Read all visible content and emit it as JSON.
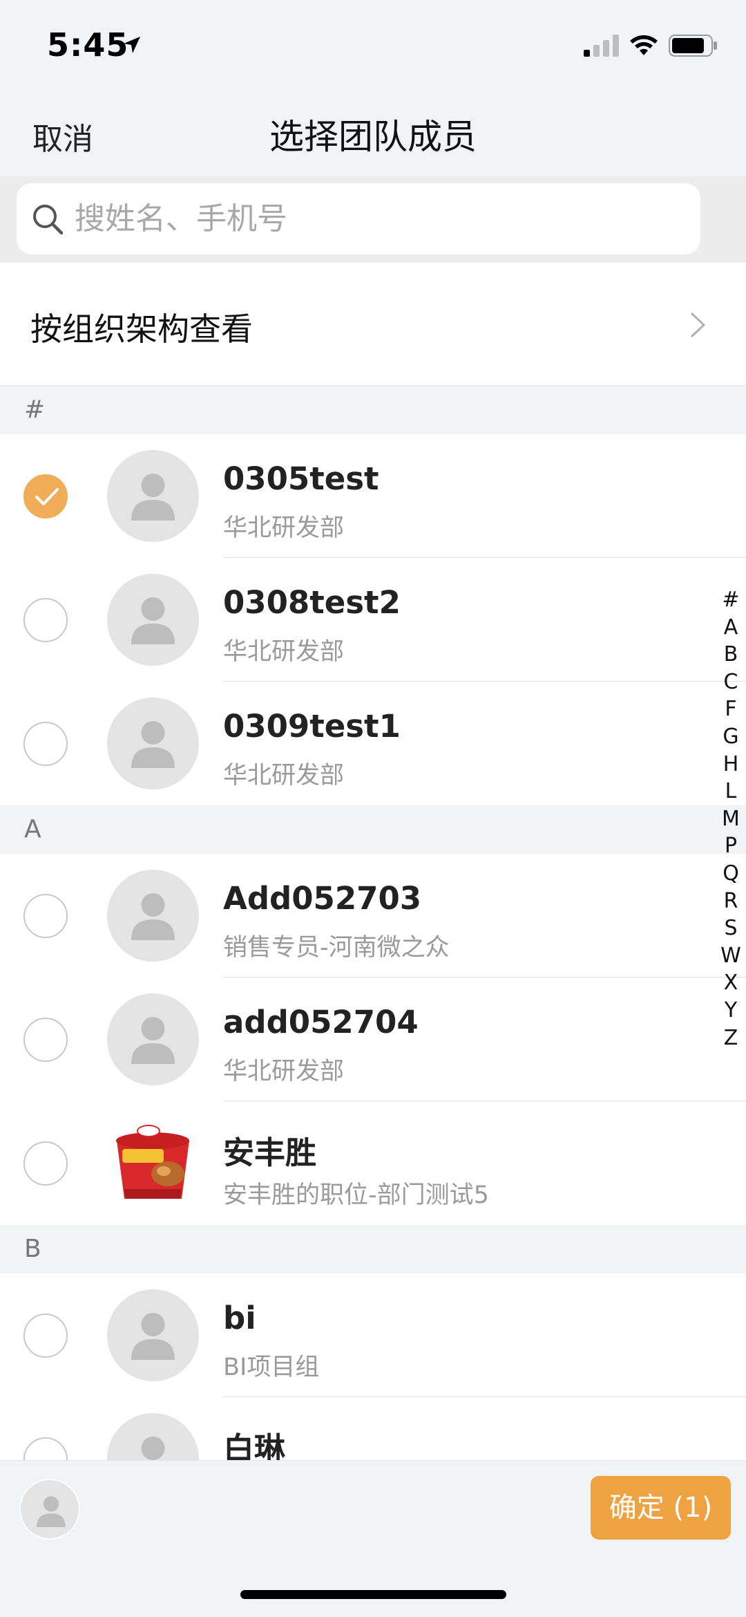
{
  "status_bar": {
    "time": "5:45"
  },
  "nav": {
    "cancel_label": "取消",
    "title": "选择团队成员"
  },
  "search": {
    "placeholder": "搜姓名、手机号"
  },
  "org": {
    "label": "按组织架构查看"
  },
  "sections": [
    {
      "letter": "#",
      "contacts": [
        {
          "name": "0305test",
          "dept": "华北研发部",
          "selected": true,
          "avatar": "default-person-icon"
        },
        {
          "name": "0308test2",
          "dept": "华北研发部",
          "selected": false,
          "avatar": "default-person-icon"
        },
        {
          "name": "0309test1",
          "dept": "华北研发部",
          "selected": false,
          "avatar": "default-person-icon"
        }
      ]
    },
    {
      "letter": "A",
      "contacts": [
        {
          "name": "Add052703",
          "dept": "销售专员-河南微之众",
          "selected": false,
          "avatar": "default-person-icon"
        },
        {
          "name": "add052704",
          "dept": "华北研发部",
          "selected": false,
          "avatar": "default-person-icon"
        },
        {
          "name": "安丰胜",
          "dept": "安丰胜的职位-部门测试5",
          "selected": false,
          "avatar": "photo-noodle-bowl"
        }
      ]
    },
    {
      "letter": "B",
      "contacts": [
        {
          "name": "bi",
          "dept": "BI项目组",
          "selected": false,
          "avatar": "default-person-icon"
        },
        {
          "name": "白琳",
          "dept": "",
          "selected": false,
          "avatar": "default-person-icon"
        }
      ]
    }
  ],
  "index_letters": [
    "#",
    "A",
    "B",
    "C",
    "F",
    "G",
    "H",
    "L",
    "M",
    "P",
    "Q",
    "R",
    "S",
    "W",
    "X",
    "Y",
    "Z"
  ],
  "bottom": {
    "confirm_label": "确定 (1)"
  },
  "colors": {
    "accent": "#efa242",
    "check": "#f0ac57"
  }
}
